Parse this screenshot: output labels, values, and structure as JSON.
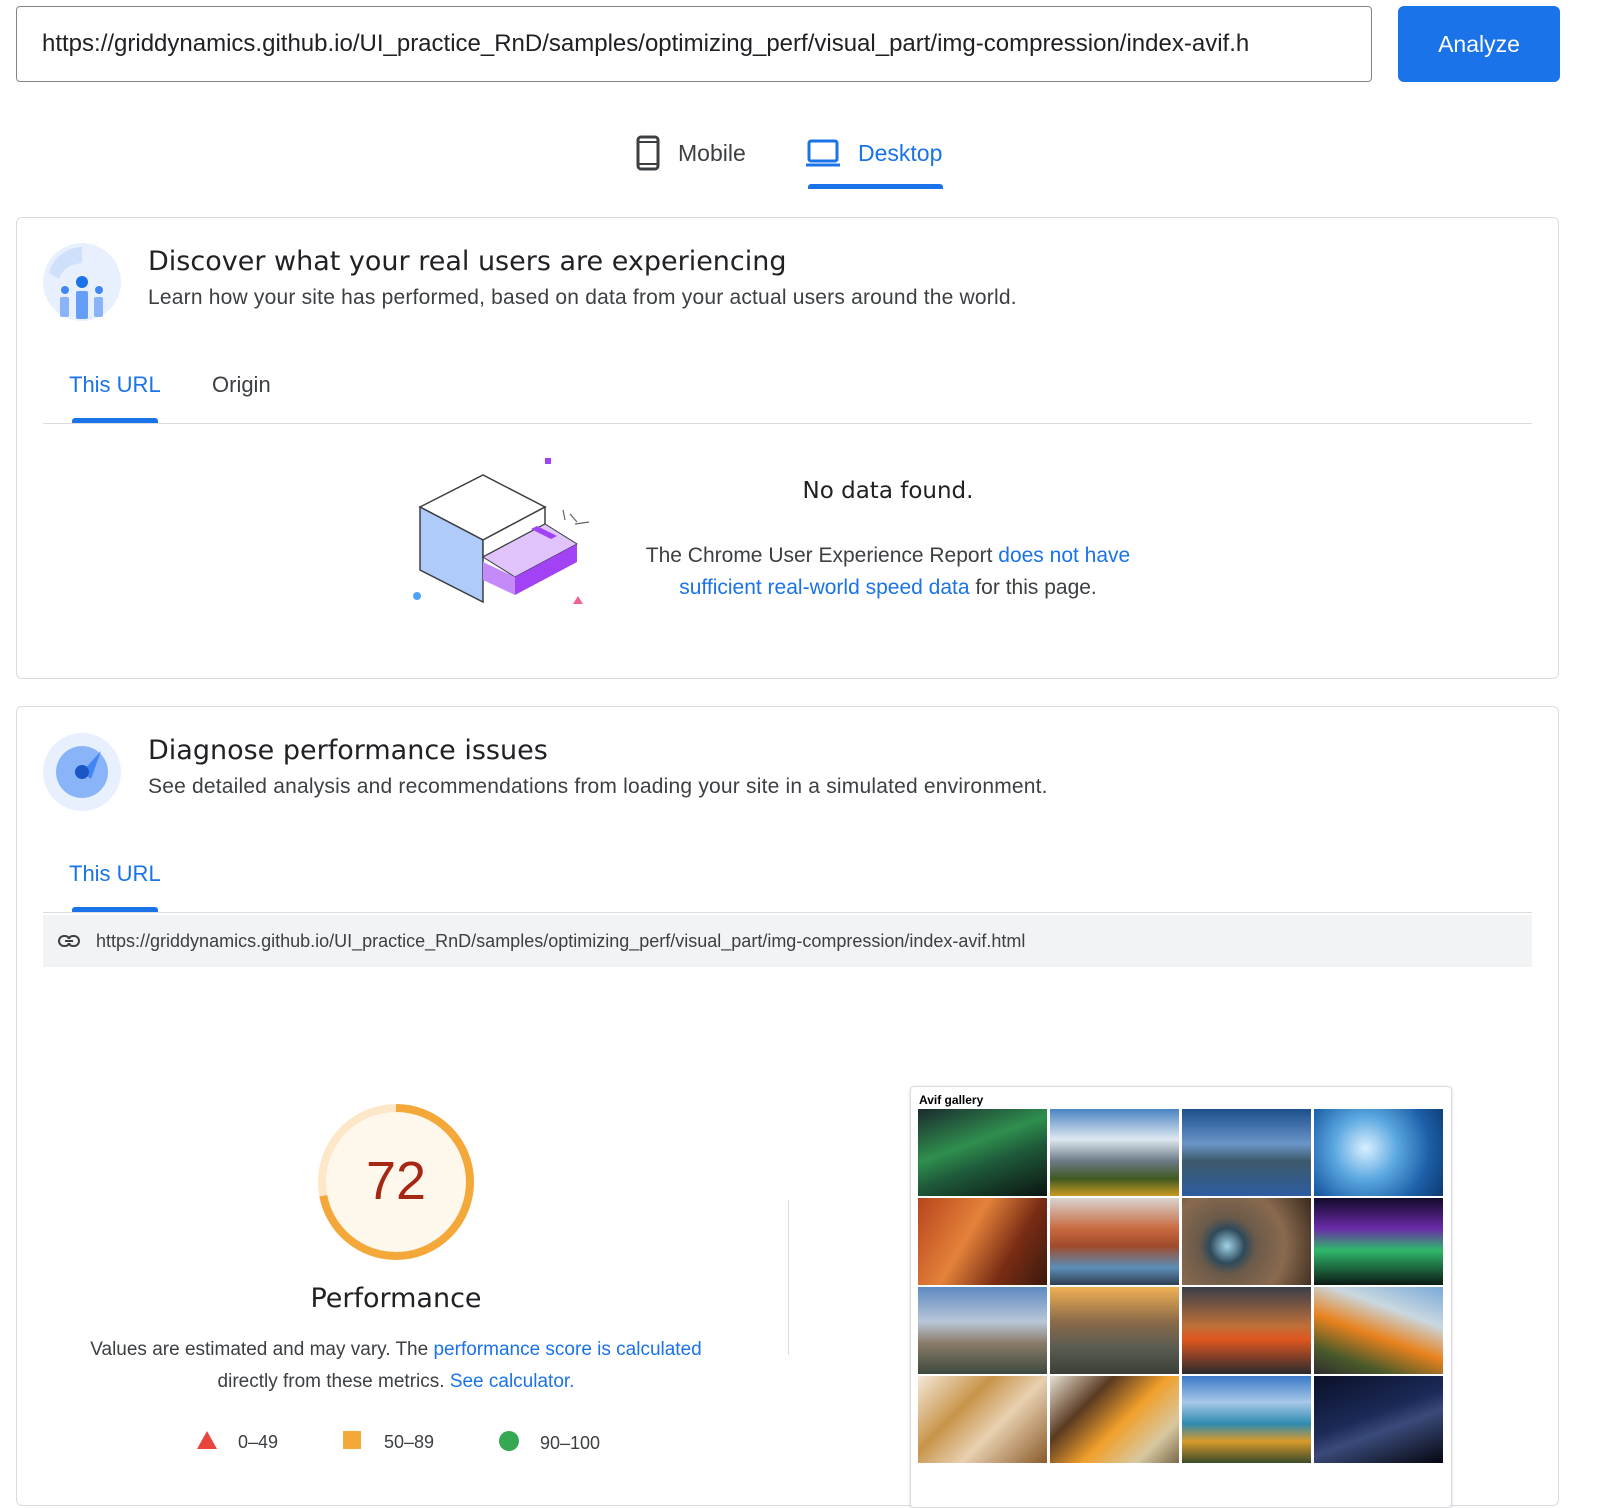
{
  "url_bar": {
    "value": "https://griddynamics.github.io/UI_practice_RnD/samples/optimizing_perf/visual_part/img-compression/index-avif.h",
    "analyze_label": "Analyze"
  },
  "device_tabs": {
    "mobile_label": "Mobile",
    "desktop_label": "Desktop",
    "active": "Desktop"
  },
  "field_data": {
    "title": "Discover what your real users are experiencing",
    "subtitle": "Learn how your site has performed, based on data from your actual users around the world.",
    "tabs": [
      "This URL",
      "Origin"
    ],
    "empty_state": {
      "heading": "No data found.",
      "text_before": "The Chrome User Experience Report ",
      "link_text_1": "does not have",
      "link_text_2": "sufficient real-world speed data",
      "text_after": " for this page."
    }
  },
  "lab_data": {
    "title": "Diagnose performance issues",
    "subtitle": "See detailed analysis and recommendations from loading your site in a simulated environment.",
    "tab": "This URL",
    "tested_url": "https://griddynamics.github.io/UI_practice_RnD/samples/optimizing_perf/visual_part/img-compression/index-avif.html",
    "score": {
      "value": "72",
      "fraction": 0.72,
      "label": "Performance",
      "note_before": "Values are estimated and may vary. The ",
      "note_link": "performance score is calculated",
      "note_line2": "directly from these metrics. ",
      "calc_link": "See calculator."
    },
    "legend": [
      {
        "range": "0–49",
        "color": "#e8453c"
      },
      {
        "range": "50–89",
        "color": "#f4a83a"
      },
      {
        "range": "90–100",
        "color": "#34a853"
      }
    ],
    "screenshot": {
      "title": "Avif gallery"
    }
  },
  "colors": {
    "accent": "#1a73e8",
    "score_average": "#f4a83a",
    "score_text": "#a52714"
  }
}
